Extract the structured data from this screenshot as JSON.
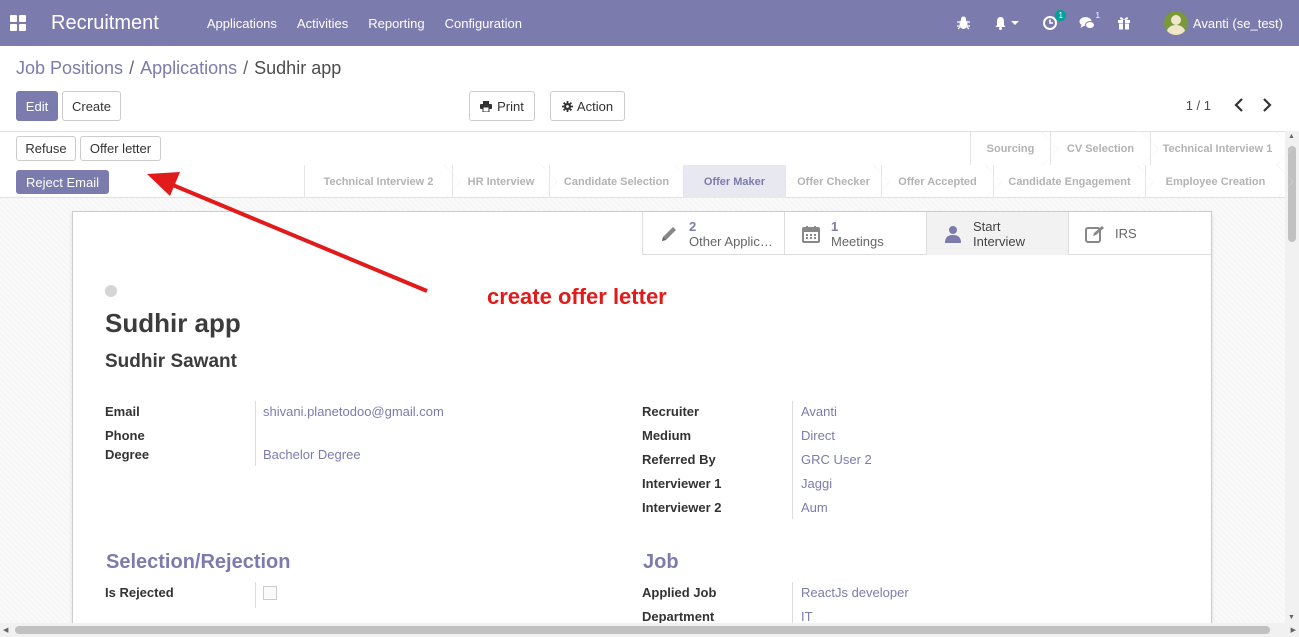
{
  "navbar": {
    "app_title": "Recruitment",
    "menu": [
      "Applications",
      "Activities",
      "Reporting",
      "Configuration"
    ],
    "activity_badge": "1",
    "messages_badge": "1",
    "user_name": "Avanti (se_test)",
    "brand_color": "#7c7bad"
  },
  "breadcrumb": {
    "level1": "Job Positions",
    "level2": "Applications",
    "current": "Sudhir app",
    "separator": "/"
  },
  "toolbar": {
    "edit": "Edit",
    "create": "Create",
    "print": "Print",
    "action": "Action",
    "pager": "1 / 1"
  },
  "status_buttons": {
    "refuse": "Refuse",
    "offer_letter": "Offer letter",
    "reject_email": "Reject Email"
  },
  "stages": {
    "row1": [
      "Sourcing",
      "CV Selection",
      "Technical Interview 1"
    ],
    "row2": [
      "Technical Interview 2",
      "HR Interview",
      "Candidate Selection",
      "Offer Maker",
      "Offer Checker",
      "Offer Accepted",
      "Candidate Engagement",
      "Employee Creation"
    ],
    "active": "Offer Maker"
  },
  "smart_buttons": {
    "other_apps_count": "2",
    "other_apps_label": "Other Applic…",
    "meetings_count": "1",
    "meetings_label": "Meetings",
    "start_interview_line1": "Start",
    "start_interview_line2": "Interview",
    "irs": "IRS"
  },
  "annotation": "create offer letter",
  "form": {
    "title": "Sudhir app",
    "partner_name": "Sudhir Sawant",
    "left_fields": [
      {
        "label": "Email",
        "value": "shivani.planetodoo@gmail.com"
      },
      {
        "label": "Phone",
        "value": ""
      },
      {
        "label": "Degree",
        "value": "Bachelor Degree"
      }
    ],
    "right_fields": [
      {
        "label": "Recruiter",
        "value": "Avanti"
      },
      {
        "label": "Medium",
        "value": "Direct"
      },
      {
        "label": "Referred By",
        "value": "GRC User 2"
      },
      {
        "label": "Interviewer 1",
        "value": "Jaggi"
      },
      {
        "label": "Interviewer 2",
        "value": "Aum"
      }
    ],
    "section_left": "Selection/Rejection",
    "is_rejected_label": "Is Rejected",
    "is_rejected": false,
    "section_right": "Job",
    "applied_job_label": "Applied Job",
    "applied_job": "ReactJs developer",
    "department_label": "Department",
    "department": "IT"
  }
}
